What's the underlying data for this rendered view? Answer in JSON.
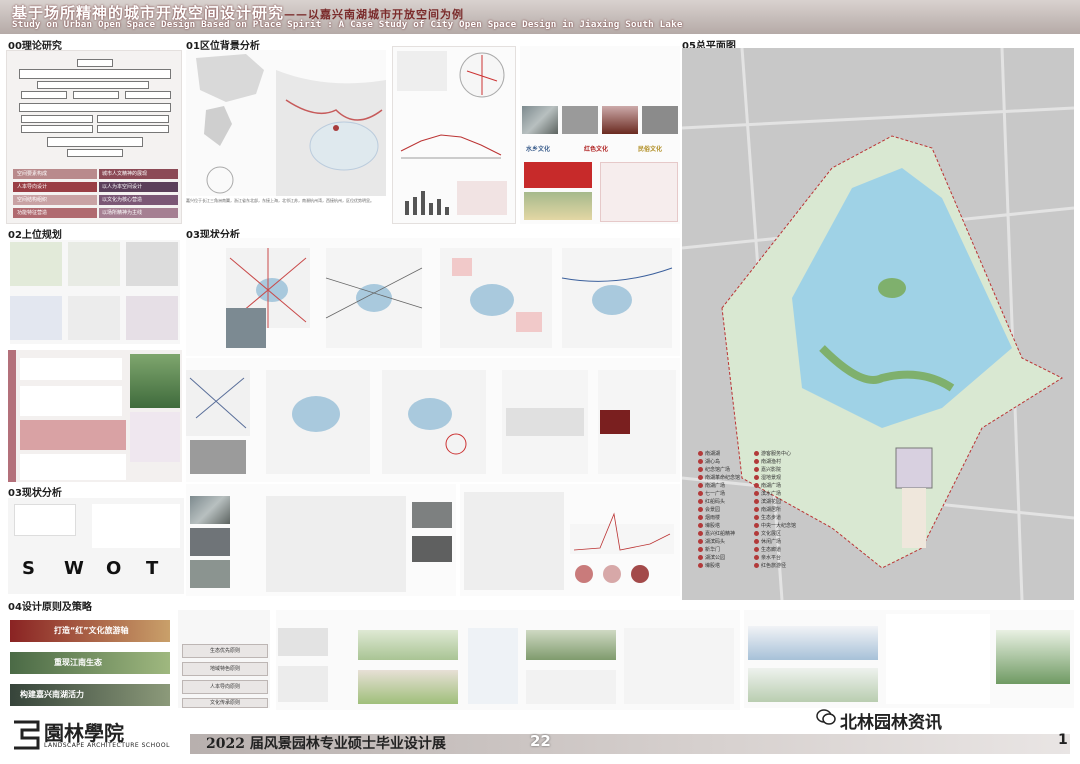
{
  "header": {
    "title_cn": "基于场所精神的城市开放空间设计研究",
    "subtitle_cn": "——以嘉兴南湖城市开放空间为例",
    "title_en": "Study on Urban Open Space Design Based on Place Spirit : A Case Study of City Open Space Design in Jiaxing South Lake"
  },
  "sections": {
    "s00": "00理论研究",
    "s01": "01区位背景分析",
    "s02": "02上位规划",
    "s03a": "03现状分析",
    "s03b": "03现状分析",
    "s04": "04设计原则及策略",
    "s05": "05总平面图"
  },
  "swot": [
    "S",
    "W",
    "O",
    "T"
  ],
  "culture_tags": [
    "水乡文化",
    "红色文化",
    "民俗文化"
  ],
  "theory_items": [
    "空间要素构成",
    "人本导向设计",
    "空间结构组织",
    "功能特征营造"
  ],
  "theory_items_right": [
    "城市人文精神的展现",
    "以人为本空间设计",
    "以文化为核心营造",
    "以场所精神为主线"
  ],
  "principles": [
    "打造“红”文化旅游轴",
    "重现江南生态",
    "构建嘉兴南湖活力"
  ],
  "strategy_pills": [
    "生态优先原则",
    "地域特色原则",
    "人本导向原则",
    "文化传承原则"
  ],
  "legend": {
    "left": [
      "南湖湖",
      "湖心岛",
      "纪念馆广场",
      "南湖革命纪念馆",
      "南湖广场",
      "七一广场",
      "红船码头",
      "会景园",
      "烟雨楼",
      "壕股塔",
      "嘉兴红船精神",
      "湖滨码头",
      "新华门",
      "湖滨公园",
      "壕股塔"
    ],
    "right": [
      "游客服务中心",
      "南湖渔村",
      "嘉兴影院",
      "湿地景观",
      "南湖广场",
      "滨水广场",
      "滨湖花园",
      "南湖居所",
      "生态步道",
      "中央一大纪念馆",
      "文化展区",
      "休闲广场",
      "生态廊道",
      "亲水平台",
      "红色旅游径"
    ]
  },
  "footer": {
    "logo": "園林學院",
    "logo_sub": "LANDSCAPE  ARCHITECTURE SCHOOL",
    "title": "2022 届风景园林专业硕士毕业设计展",
    "year_mark": "22",
    "page": "1",
    "watermark": "北林园林资讯"
  }
}
